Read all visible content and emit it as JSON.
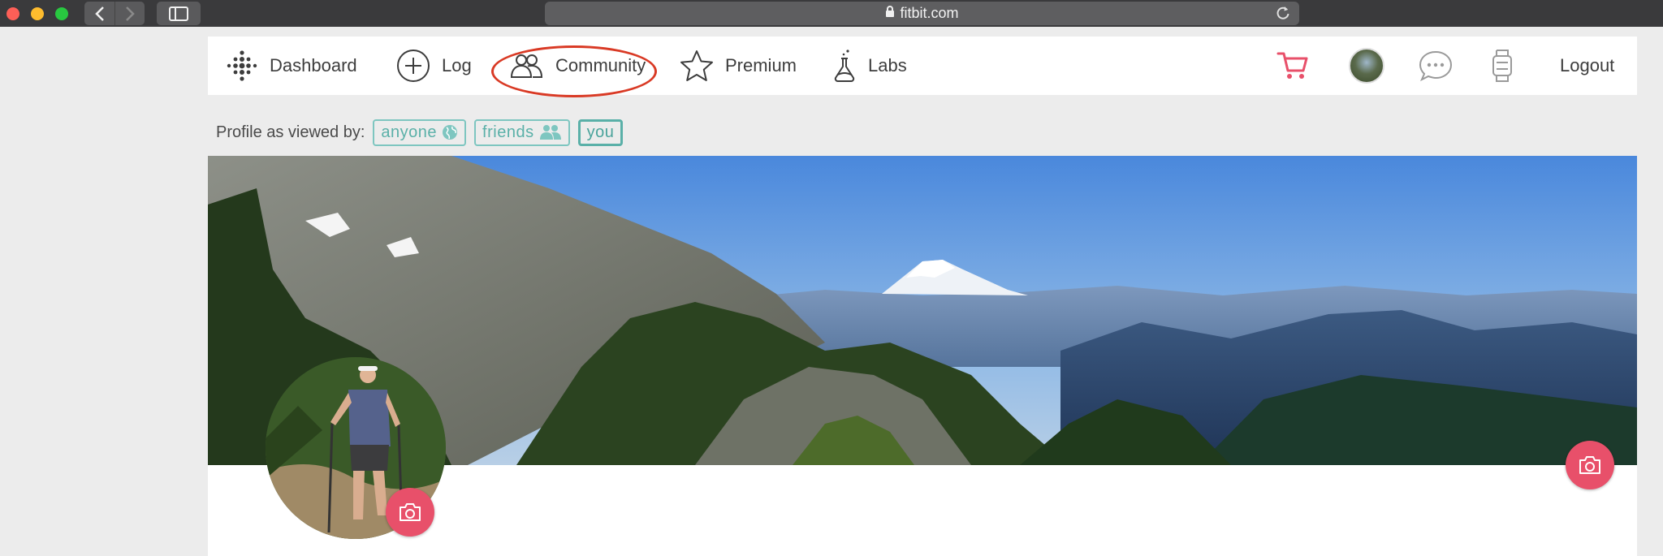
{
  "browser": {
    "url": "fitbit.com"
  },
  "nav": {
    "dashboard": "Dashboard",
    "log": "Log",
    "community": "Community",
    "premium": "Premium",
    "labs": "Labs",
    "logout": "Logout"
  },
  "profile_view": {
    "label": "Profile as viewed by:",
    "options": [
      {
        "label": "anyone",
        "icon": "globe-icon"
      },
      {
        "label": "friends",
        "icon": "friends-icon"
      },
      {
        "label": "you",
        "icon": ""
      }
    ],
    "selected": "you"
  },
  "colors": {
    "accent_teal": "#5ab0a8",
    "accent_pink": "#e8506a",
    "annotation_red": "#d93a25"
  },
  "icons": {
    "dashboard": "fitbit-dots-icon",
    "log": "plus-circle-icon",
    "community": "people-icon",
    "premium": "star-icon",
    "labs": "flask-icon",
    "cart": "cart-icon",
    "messages": "chat-bubble-icon",
    "device": "watch-icon",
    "camera": "camera-icon"
  }
}
